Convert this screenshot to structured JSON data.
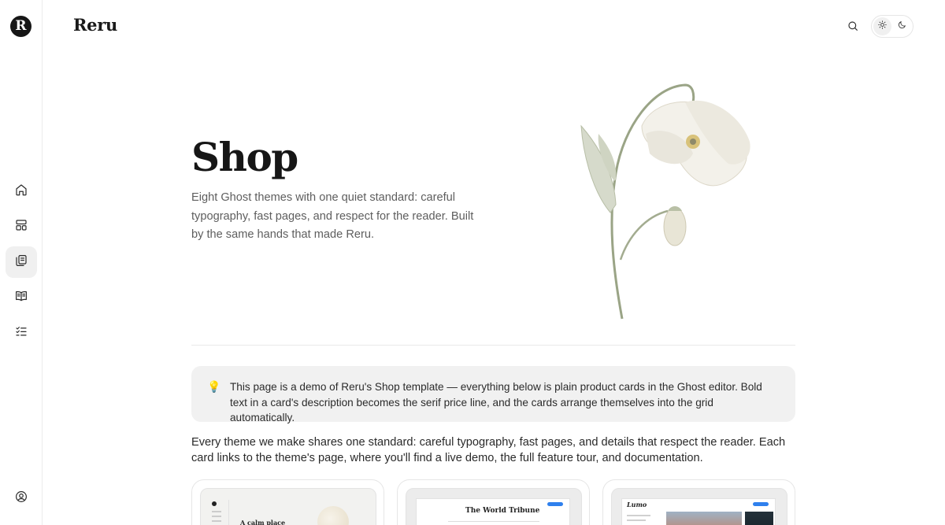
{
  "brand": {
    "logo_letter": "R",
    "name": "Reru"
  },
  "rail": {
    "items": [
      {
        "icon": "home-icon"
      },
      {
        "icon": "layout-icon"
      },
      {
        "icon": "copy-icon"
      },
      {
        "icon": "book-icon"
      },
      {
        "icon": "checklist-icon"
      }
    ],
    "account_icon": "user-circle-icon"
  },
  "header": {
    "search_icon": "search-icon",
    "theme_toggle": {
      "light_icon": "sun-icon",
      "dark_icon": "moon-icon"
    }
  },
  "hero": {
    "title": "Shop",
    "subtitle": "Eight Ghost themes with one quiet standard: careful typography, fast pages, and respect for the reader. Built by the same hands that made Reru."
  },
  "callout": {
    "icon": "lightbulb-icon",
    "text": "This page is a demo of Reru's Shop template — everything below is plain product cards in the Ghost editor. Bold text in a card's description becomes the serif price line, and the cards arrange themselves into the grid automatically."
  },
  "intro": "Every theme we make shares one standard: careful typography, fast pages, and details that respect the reader. Each card links to the theme's page, where you'll find a live demo, the full feature tour, and documentation.",
  "cards": [
    {
      "thumb_text": "A calm place"
    },
    {
      "thumb_text": "The World Tribune"
    },
    {
      "thumb_text": "Lumo"
    }
  ],
  "colors": {
    "accent_blue": "#2f80ed",
    "text_dark": "#161616",
    "text_muted": "#5e5e5e",
    "callout_bg": "#f1f1f1"
  }
}
